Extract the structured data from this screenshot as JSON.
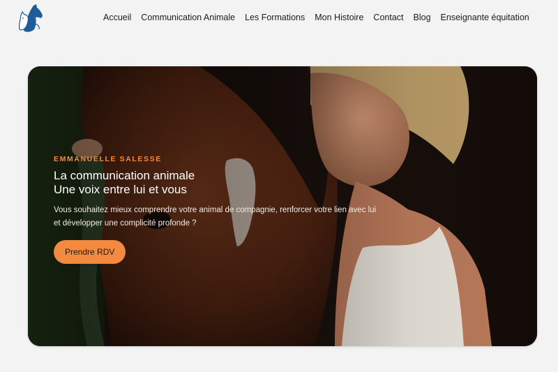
{
  "header": {
    "logo_icon": "cat-horse-silhouette-logo",
    "nav": [
      {
        "label": "Accueil"
      },
      {
        "label": "Communication Animale"
      },
      {
        "label": "Les Formations"
      },
      {
        "label": "Mon Histoire"
      },
      {
        "label": "Contact"
      },
      {
        "label": "Blog"
      },
      {
        "label": "Enseignante équitation"
      }
    ]
  },
  "hero": {
    "eyebrow": "EMMANUELLE SALESSE",
    "headline_line1": "La communication animale",
    "headline_line2": "Une voix entre lui et vous",
    "lede_line1": "Vous souhaitez mieux comprendre votre animal de compagnie, renforcer votre lien avec lui",
    "lede_line2": "et développer une complicité profonde ?",
    "cta_label": "Prendre RDV"
  },
  "colors": {
    "accent": "#f48a3f",
    "page_bg": "#f3f3f3",
    "logo_blue": "#1f5d99"
  }
}
